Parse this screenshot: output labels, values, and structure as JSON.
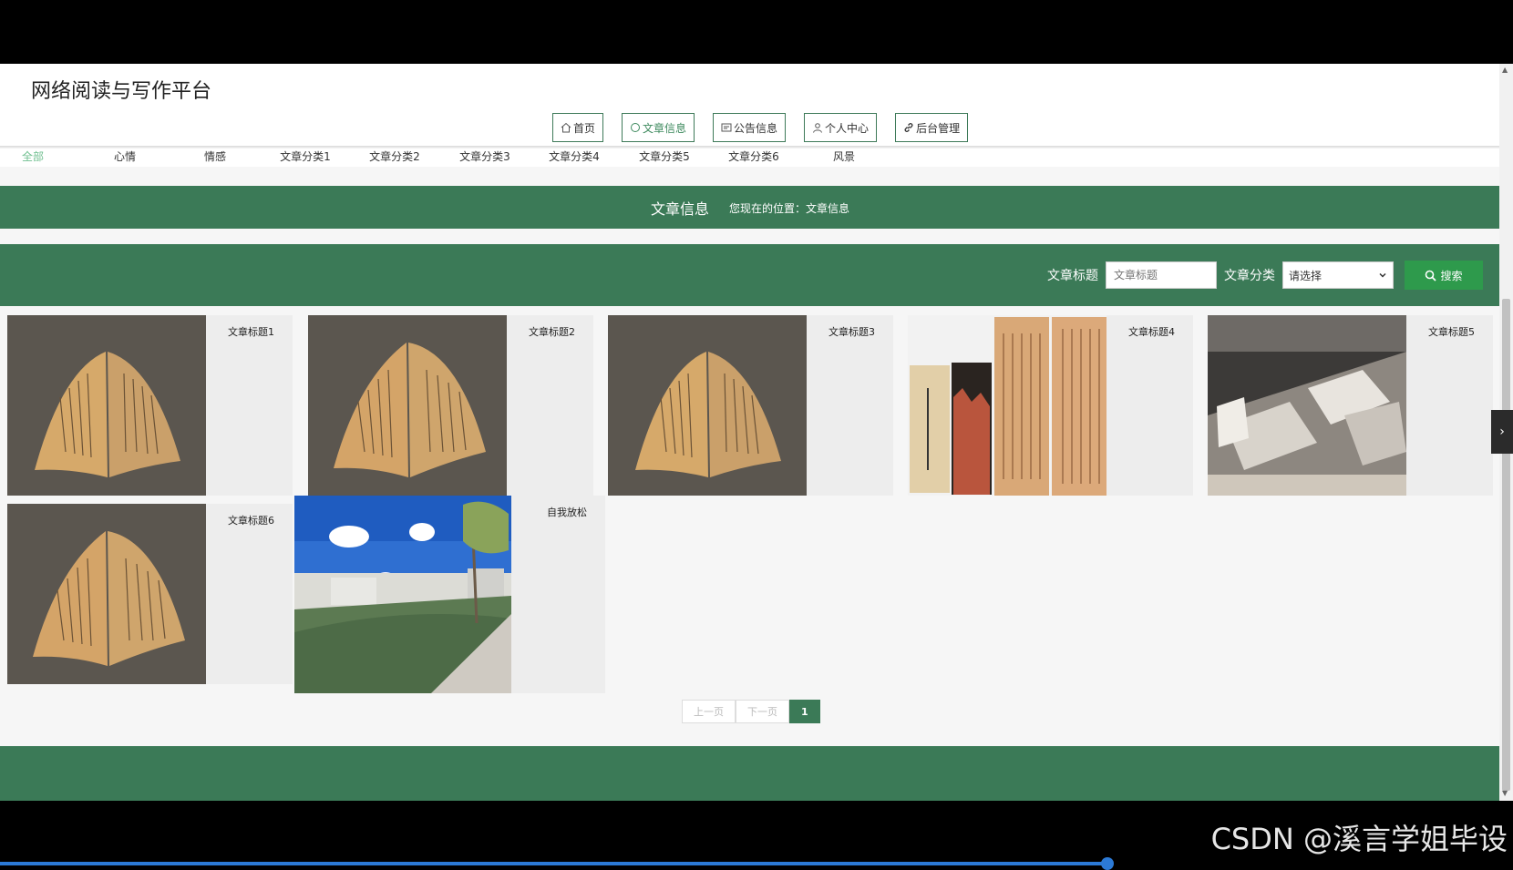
{
  "site": {
    "title": "网络阅读与写作平台"
  },
  "nav": [
    {
      "label": "首页",
      "icon": "home-icon"
    },
    {
      "label": "文章信息",
      "icon": "circle-icon",
      "active": true
    },
    {
      "label": "公告信息",
      "icon": "notice-icon"
    },
    {
      "label": "个人中心",
      "icon": "user-icon"
    },
    {
      "label": "后台管理",
      "icon": "link-icon"
    }
  ],
  "categories": [
    "全部",
    "心情",
    "情感",
    "文章分类1",
    "文章分类2",
    "文章分类3",
    "文章分类4",
    "文章分类5",
    "文章分类6",
    "风景"
  ],
  "banner": {
    "title": "文章信息",
    "location": "您现在的位置：文章信息"
  },
  "search": {
    "title_label": "文章标题",
    "title_placeholder": "文章标题",
    "category_label": "文章分类",
    "category_value": "请选择",
    "button_label": "搜索"
  },
  "articles": [
    {
      "title": "文章标题1"
    },
    {
      "title": "文章标题2"
    },
    {
      "title": "文章标题3"
    },
    {
      "title": "文章标题4"
    },
    {
      "title": "文章标题5"
    },
    {
      "title": "文章标题6"
    },
    {
      "title": "自我放松"
    }
  ],
  "pager": {
    "prev": "上一页",
    "next": "下一页",
    "current": "1"
  },
  "watermark": "CSDN @溪言学姐毕设",
  "colors": {
    "brand_green": "#3b7a57",
    "search_green": "#2e9a4c"
  }
}
